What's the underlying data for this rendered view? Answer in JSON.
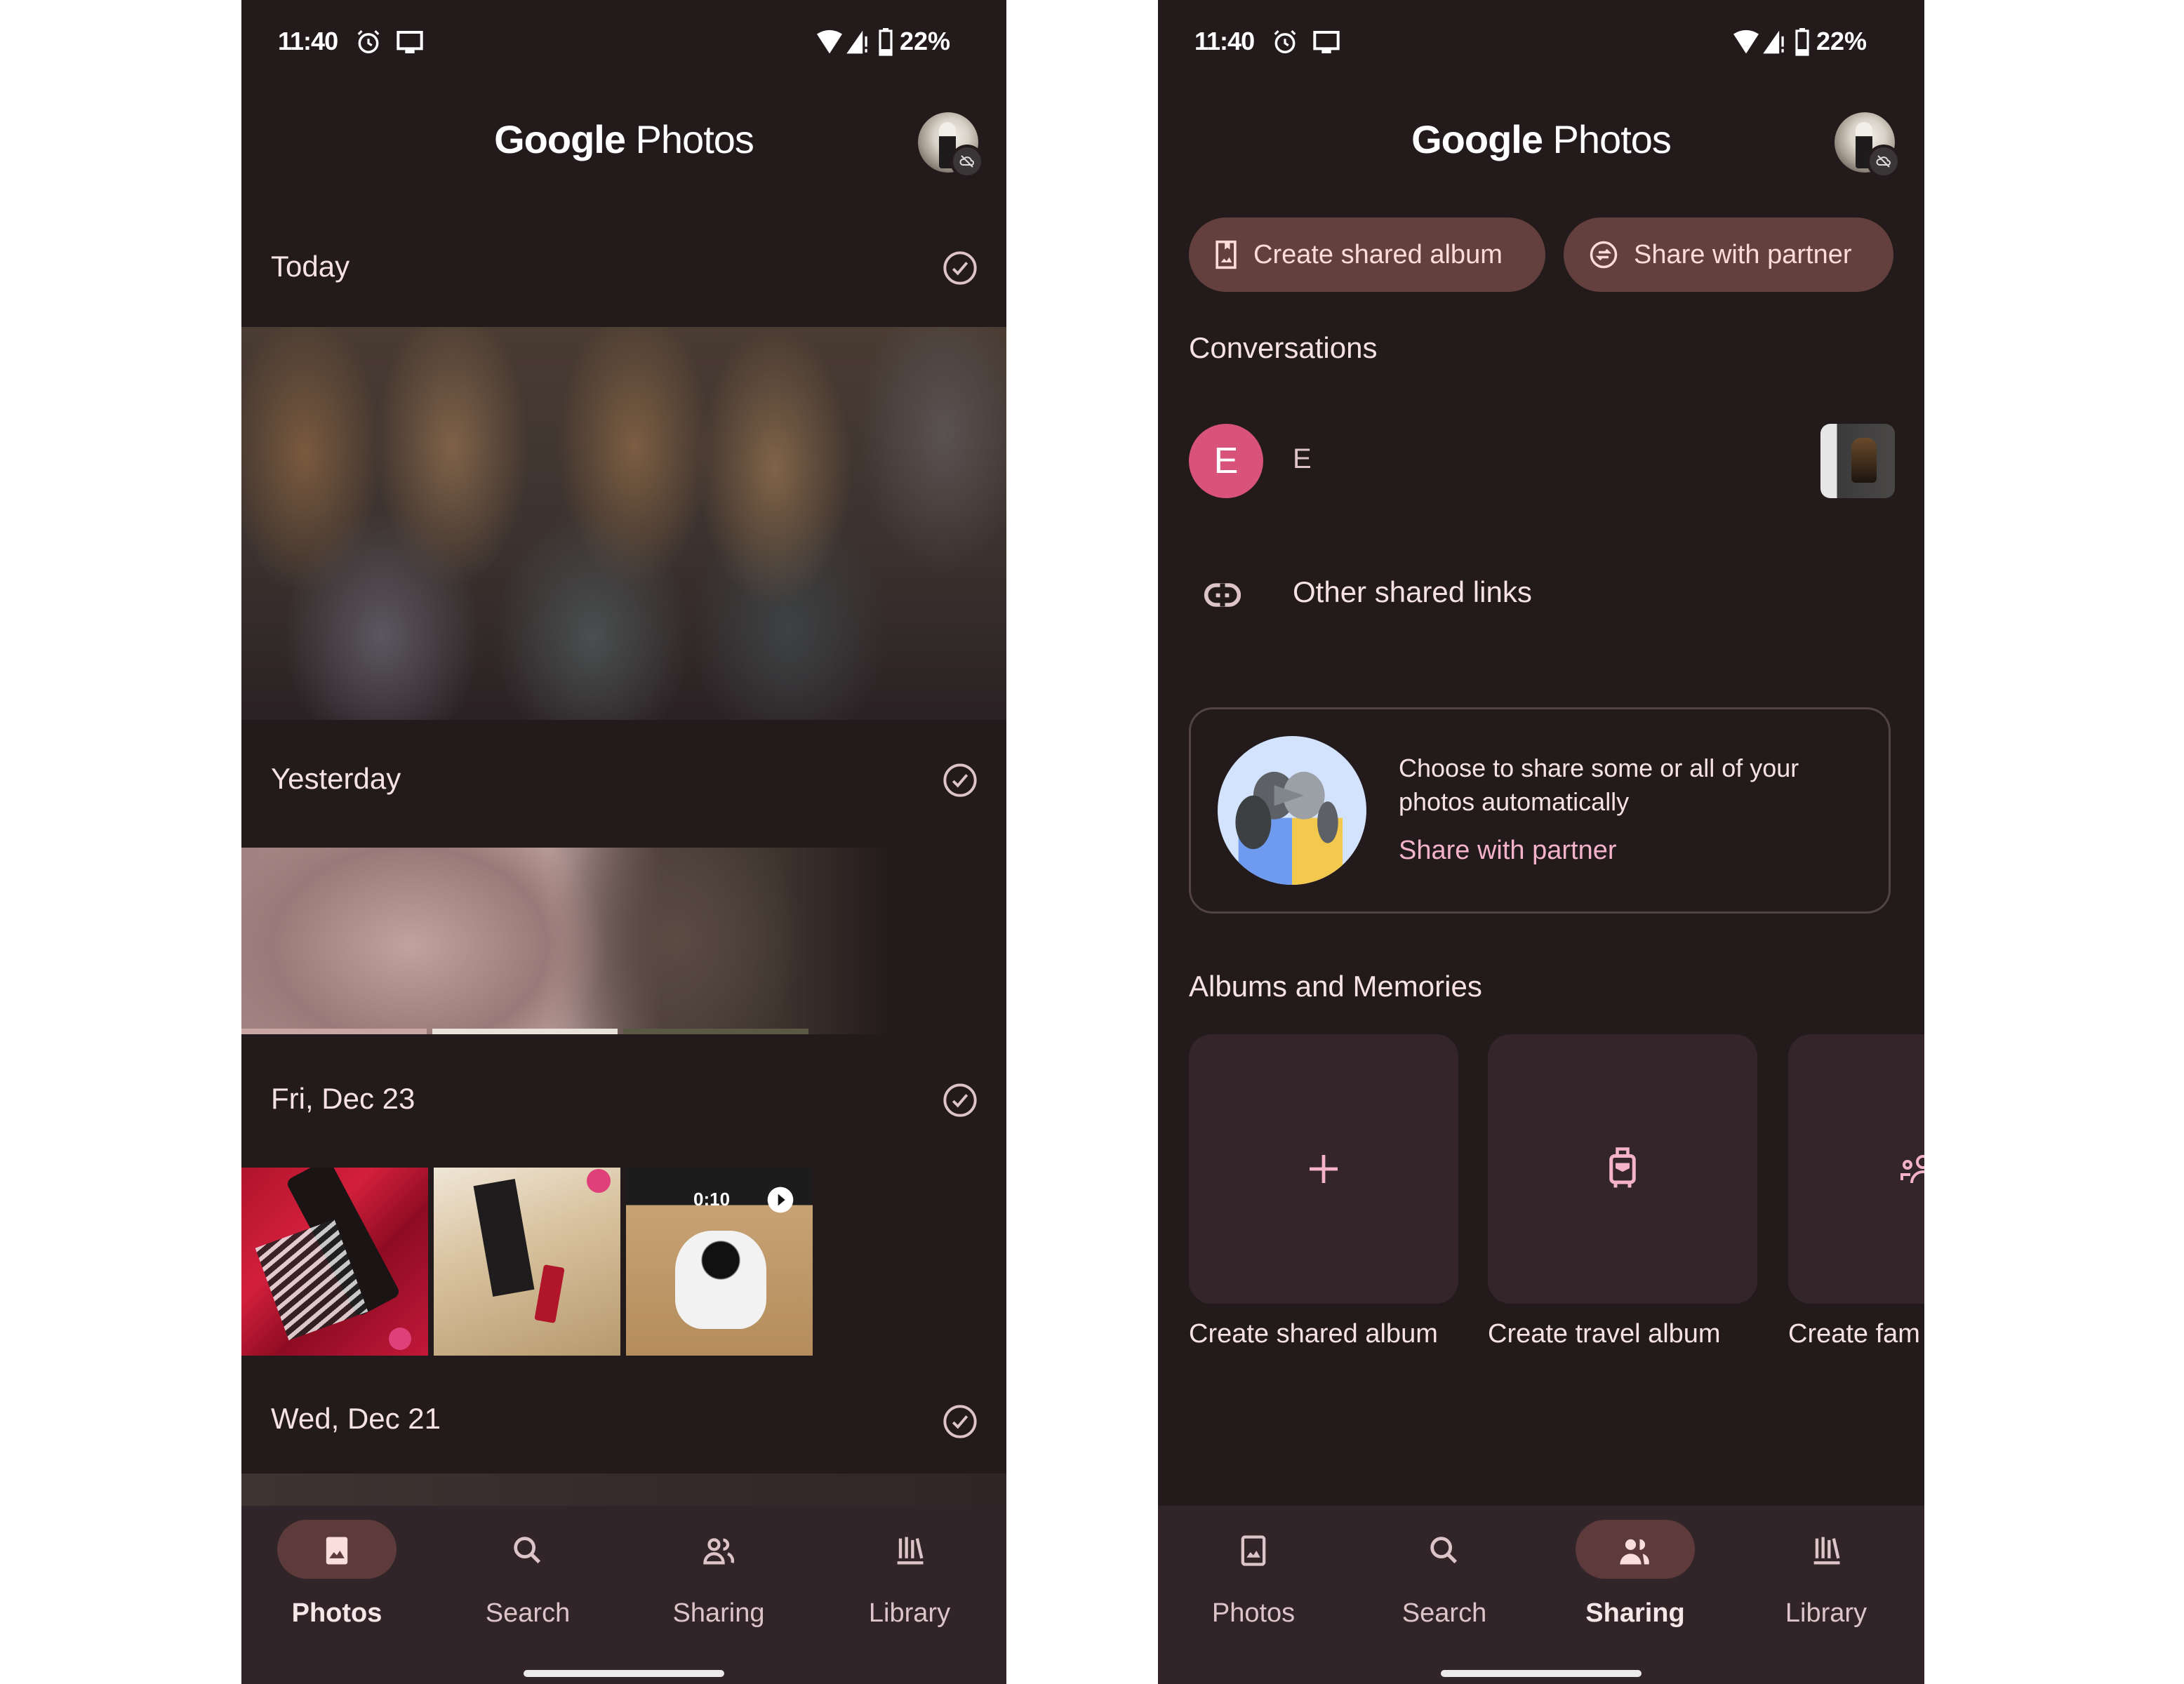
{
  "status_bar": {
    "time": "11:40",
    "battery": "22%",
    "icons": [
      "alarm-icon",
      "cast-icon",
      "wifi-icon",
      "signal-icon",
      "battery-icon"
    ]
  },
  "app": {
    "title_brand": "Google",
    "title_product": "Photos"
  },
  "left_screen": {
    "sections": [
      {
        "label": "Today"
      },
      {
        "label": "Yesterday"
      },
      {
        "label": "Fri, Dec 23"
      },
      {
        "label": "Wed, Dec 21"
      }
    ],
    "video_thumb": {
      "duration": "0:10"
    }
  },
  "right_screen": {
    "chips": {
      "create_shared_album": "Create shared album",
      "share_with_partner": "Share with partner"
    },
    "conversations_heading": "Conversations",
    "conversation": {
      "initial": "E",
      "name": "E"
    },
    "other_links": "Other shared links",
    "partner_card": {
      "text": "Choose to share some or all of your photos automatically",
      "link": "Share with partner"
    },
    "albums_heading": "Albums and Memories",
    "albums": [
      {
        "label": "Create shared album",
        "icon": "plus-icon"
      },
      {
        "label": "Create travel album",
        "icon": "luggage-icon"
      },
      {
        "label": "Create fam",
        "icon": "family-icon"
      }
    ]
  },
  "nav": {
    "items": [
      {
        "label": "Photos"
      },
      {
        "label": "Search"
      },
      {
        "label": "Sharing"
      },
      {
        "label": "Library"
      }
    ],
    "left_active": "Photos",
    "right_active": "Sharing"
  },
  "colors": {
    "background": "#231a1c",
    "nav": "#32252a",
    "chip": "#633f3e",
    "accent_pink": "#f4b3c9",
    "avatar_e": "#d9527a",
    "active_pill": "#5e3b3b"
  }
}
